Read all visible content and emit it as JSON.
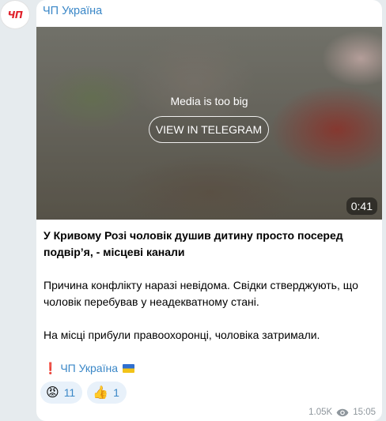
{
  "channel": {
    "avatar_text": "ЧП",
    "name": "ЧП Україна"
  },
  "media": {
    "notice": "Media is too big",
    "button_label": "VIEW IN TELEGRAM",
    "duration": "0:41"
  },
  "post": {
    "headline": "У Кривому Розі чоловік душив дитину просто посеред подвір’я, - місцеві канали",
    "paragraph1": "Причина конфлікту наразі невідома. Свідки стверджують, що чоловік перебував у неадекватному стані.",
    "paragraph2": "На місці прибули правоохоронці, чоловіка затримали.",
    "signature_mark": "❗",
    "signature": "ЧП Україна"
  },
  "reactions": [
    {
      "icon": "angry-face-icon",
      "emoji": "😡",
      "count": "11"
    },
    {
      "icon": "thumbs-up-icon",
      "emoji": "👍",
      "count": "1"
    }
  ],
  "meta": {
    "views": "1.05K",
    "time": "15:05"
  },
  "colors": {
    "link": "#3a87c7",
    "background": "#e6ebee",
    "avatar_red": "#e0202a"
  }
}
